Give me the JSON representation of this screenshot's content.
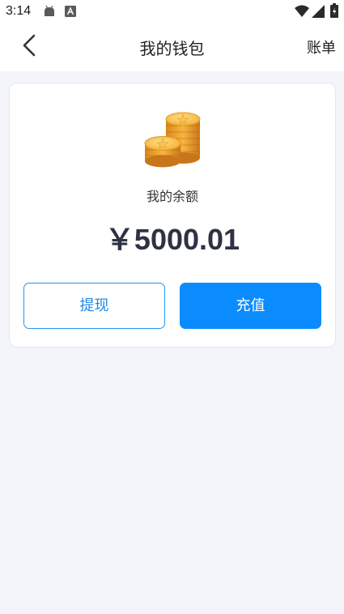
{
  "status_bar": {
    "time": "3:14",
    "icons": [
      "android-icon",
      "a-notification-icon",
      "wifi-icon",
      "signal-icon",
      "battery-icon"
    ]
  },
  "nav": {
    "title": "我的钱包",
    "back_icon": "chevron-left-icon",
    "bill_label": "账单"
  },
  "wallet": {
    "icon": "coin-stack-icon",
    "balance_label": "我的余额",
    "balance_amount": "￥5000.01",
    "withdraw_label": "提现",
    "recharge_label": "充值"
  },
  "colors": {
    "accent": "#0a8cff",
    "background": "#f4f5fa",
    "amount_text": "#2f3244"
  }
}
